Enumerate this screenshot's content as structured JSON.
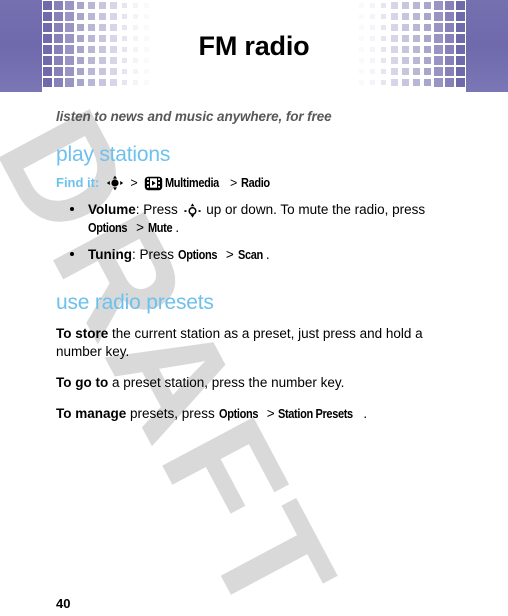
{
  "header": {
    "title": "FM radio",
    "band_color": "#6f6aab"
  },
  "watermark": {
    "text": "DRAFT",
    "color": "#d9d9d9"
  },
  "tagline": "listen to news and music anywhere, for free",
  "accent_color": "#6ec1ec",
  "sections": [
    {
      "heading": "play stations",
      "find_it": {
        "label": "Find it:",
        "nav_icon": "navigation-key-icon",
        "separator1": ">",
        "app_icon": "multimedia-icon",
        "menu1": "Multimedia",
        "separator2": ">",
        "menu2": "Radio"
      },
      "bullets": [
        {
          "term": "Volume",
          "text_before_icon": ": Press ",
          "icon": "scroll-key-icon",
          "text_after_icon": " up or down. To mute the radio, press ",
          "menu1": "Options",
          "separator": " > ",
          "menu2": "Mute",
          "end": "."
        },
        {
          "term": "Tuning",
          "text_before_icon": ": Press ",
          "menu1": "Options",
          "separator": " > ",
          "menu2": "Scan",
          "end": "."
        }
      ]
    },
    {
      "heading": "use radio presets",
      "paragraphs": [
        {
          "lead": "To store",
          "body": " the current station as a preset, just press and hold a number key."
        },
        {
          "lead": "To go to",
          "body": " a preset station, press the number key."
        },
        {
          "lead": "To manage",
          "body": " presets, press ",
          "menu1": "Options",
          "separator": " > ",
          "menu2": "Station Presets",
          "end": "."
        }
      ]
    }
  ],
  "page_number": "40"
}
